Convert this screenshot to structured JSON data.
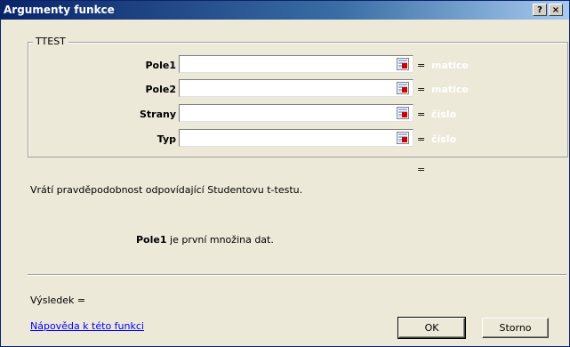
{
  "window": {
    "title": "Argumenty funkce",
    "help_glyph": "?",
    "close_glyph": "×"
  },
  "function": {
    "name": "TTEST"
  },
  "arguments": [
    {
      "label": "Pole1",
      "value": "",
      "type_hint": "matice"
    },
    {
      "label": "Pole2",
      "value": "",
      "type_hint": "matice"
    },
    {
      "label": "Strany",
      "value": "",
      "type_hint": "číslo"
    },
    {
      "label": "Typ",
      "value": "",
      "type_hint": "číslo"
    }
  ],
  "equals_sign": "=",
  "description": "Vrátí pravděpodobnost odpovídající Studentovu t-testu.",
  "argument_help": {
    "name": "Pole1",
    "text": " je první množina dat."
  },
  "result_label": "Výsledek =",
  "help_link": "Nápověda k této funkci",
  "buttons": {
    "ok": "OK",
    "cancel": "Storno"
  },
  "icons": {
    "ref_icon": "collapse-dialog-icon"
  },
  "colors": {
    "title_start": "#0a246a",
    "title_end": "#a6caf0",
    "dialog_bg": "#ece9d8",
    "hint_text": "#ffffff",
    "link": "#0000ff"
  }
}
